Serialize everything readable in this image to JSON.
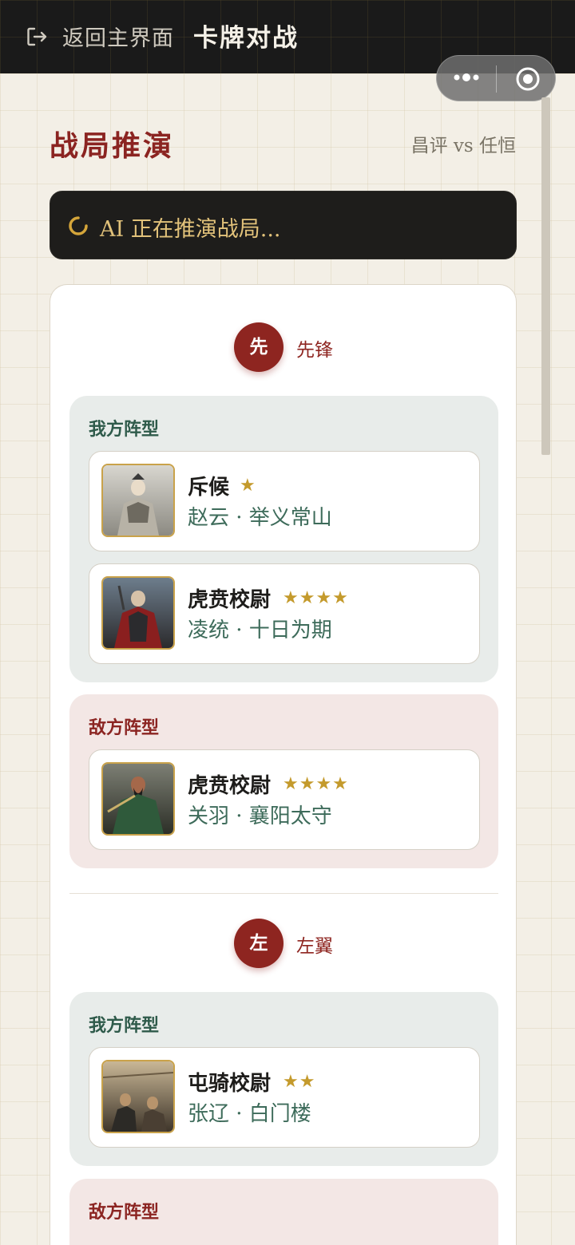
{
  "topbar": {
    "back_label": "返回主界面",
    "title": "卡牌对战"
  },
  "header": {
    "section_title": "战局推演",
    "matchup": "昌评 vs 任恒"
  },
  "ai_status": {
    "text": "AI 正在推演战局..."
  },
  "colors": {
    "accent_red": "#8e2520",
    "gold": "#c49a2c",
    "ours_green": "#2e5a4a"
  },
  "positions": [
    {
      "badge": "先",
      "name": "先锋",
      "ours": {
        "label": "我方阵型",
        "heroes": [
          {
            "rank": "斥候",
            "stars": "★",
            "sub": "赵云 · 举义常山"
          },
          {
            "rank": "虎贲校尉",
            "stars": "★★★★",
            "sub": "凌统 · 十日为期"
          }
        ]
      },
      "enemy": {
        "label": "敌方阵型",
        "heroes": [
          {
            "rank": "虎贲校尉",
            "stars": "★★★★",
            "sub": "关羽 · 襄阳太守"
          }
        ]
      }
    },
    {
      "badge": "左",
      "name": "左翼",
      "ours": {
        "label": "我方阵型",
        "heroes": [
          {
            "rank": "屯骑校尉",
            "stars": "★★",
            "sub": "张辽 · 白门楼"
          }
        ]
      },
      "enemy": {
        "label": "敌方阵型",
        "heroes": []
      }
    }
  ]
}
